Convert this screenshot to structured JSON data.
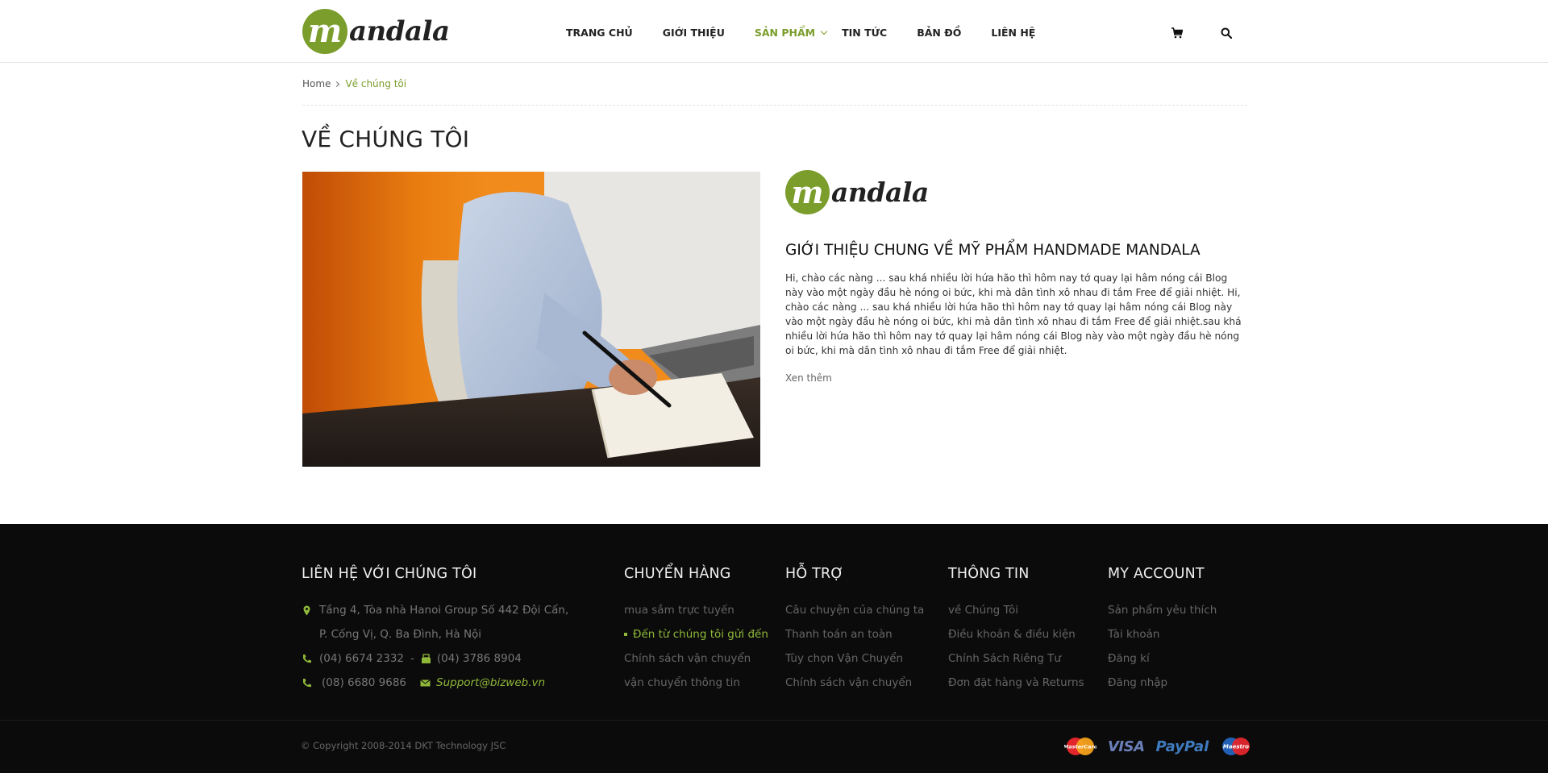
{
  "brand": {
    "logo_letter": "m",
    "logo_text": "andala",
    "color_green": "#7a9d2c",
    "color_dark": "#0b0b0b"
  },
  "nav": {
    "items": [
      {
        "label": "TRANG CHỦ"
      },
      {
        "label": "GIỚI THIỆU"
      },
      {
        "label": "SẢN PHẨM",
        "active": true,
        "dropdown": true
      },
      {
        "label": "TIN TỨC"
      },
      {
        "label": "BẢN ĐỒ"
      },
      {
        "label": "LIÊN HỆ"
      }
    ],
    "cart_icon": "cart-icon",
    "search_icon": "search-icon"
  },
  "breadcrumb": {
    "home": "Home",
    "current": "Về chúng tôi"
  },
  "page": {
    "title": "VỀ CHÚNG TÔI",
    "hero_image": "man-writing-at-desk-photo",
    "about_heading": "GIỚI THIỆU CHUNG VỀ MỸ PHẨM HANDMADE MANDALA",
    "about_text": "Hi, chào các nàng ... sau khá nhiều lời hứa hão thì hôm nay tớ quay lại hâm nóng cái Blog này vào một ngày đầu hè nóng oi bức, khi mà dân tình xô nhau đi tắm Free để giải nhiệt. Hi, chào các nàng ... sau khá nhiều lời hứa hão thì hôm nay tớ quay lại hâm nóng cái Blog này vào một ngày đầu hè nóng oi bức, khi mà dân tình xô nhau đi tắm Free để giải nhiệt.sau khá nhiều lời hứa hão thì hôm nay tớ quay lại hâm nóng cái Blog này vào một ngày đầu hè nóng oi bức, khi mà dân tình xô nhau đi tắm Free để giải nhiệt.",
    "read_more": "Xen thêm"
  },
  "footer": {
    "contact": {
      "title": "LIÊN HỆ VỚI CHÚNG TÔI",
      "address_line1": "Tầng 4, Tòa nhà Hanoi Group  Số 442 Đội Cấn,",
      "address_line2": "P. Cống Vị, Q. Ba Đình, Hà Nội",
      "phone1": "(04) 6674 2332",
      "separator": "-",
      "phone2": "(04) 3786 8904",
      "phone3": "(08) 6680 9686",
      "email": "Support@bizweb.vn"
    },
    "columns": [
      {
        "title": "CHUYỂN HÀNG",
        "items": [
          "mua sắm trực tuyến",
          "Đến từ chúng tôi gửi đến",
          "Chính sách vận chuyển",
          "vận chuyển thông tin"
        ],
        "highlight_index": 1
      },
      {
        "title": "HỖ TRỢ",
        "items": [
          "Câu chuyện của chúng ta",
          "Thanh toán an toàn",
          "Tùy chọn Vận Chuyển",
          "Chính sách vận chuyển"
        ]
      },
      {
        "title": "THÔNG TIN",
        "items": [
          "về Chúng Tôi",
          "Điều khoản & điều kiện",
          "Chính Sách Riêng Tư",
          "Đơn đặt hàng và Returns"
        ]
      },
      {
        "title": "MY ACCOUNT",
        "items": [
          "Sản phẩm yêu thích",
          "Tài khoản",
          "Đăng kí",
          "Đăng nhập"
        ]
      }
    ],
    "copyright": "© Copyright 2008-2014 DKT Technology JSC",
    "payments": {
      "mastercard": "MasterCard",
      "visa": "VISA",
      "paypal": "PayPal",
      "maestro": "Maestro"
    }
  }
}
